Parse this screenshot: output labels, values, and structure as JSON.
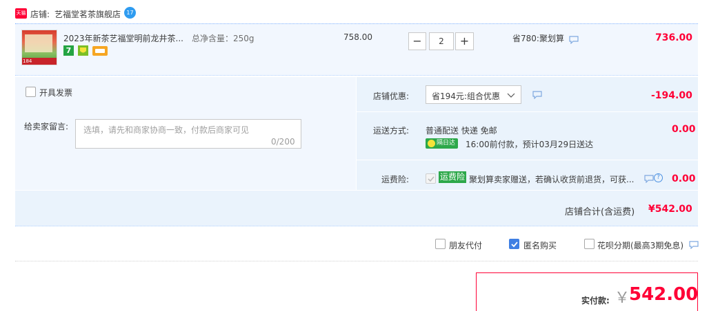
{
  "shop": {
    "badge": "天猫",
    "label": "店铺:",
    "name": "艺福堂茗茶旗舰店"
  },
  "item": {
    "thumb_badges": [
      "184",
      "口感赛艺福鲜新"
    ],
    "title": "2023年新茶艺福堂明前龙井茶...",
    "spec": "总净含量：250g",
    "service_icons": [
      "7"
    ],
    "unit_price": "758.00",
    "quantity": "2",
    "minus": "−",
    "plus": "+",
    "discount": "省780:聚划算",
    "subtotal": "736.00"
  },
  "invoice": {
    "label": "开具发票"
  },
  "message": {
    "label": "给卖家留言:",
    "placeholder": "选填，请先和商家协商一致，付款后商家可见",
    "counter": "0/200"
  },
  "shop_discount": {
    "label": "店铺优惠:",
    "select_value": "省194元:组合优惠",
    "amount": "-194.00"
  },
  "shipping": {
    "label": "运送方式:",
    "method": "普通配送 快递 免邮",
    "tag": "隔日达",
    "eta": "16:00前付款，预计03月29日送达",
    "amount": "0.00"
  },
  "insurance": {
    "label": "运费险:",
    "tag": "运费险",
    "text": "聚划算卖家赠送，若确认收货前退货，可获...",
    "amount": "0.00"
  },
  "shop_total": {
    "label": "店铺合计(含运费)",
    "amount": "¥542.00"
  },
  "options": {
    "friend_pay": "朋友代付",
    "anonymous": "匿名购买",
    "anonymous_checked": true,
    "huabei": "花呗分期(最高3期免息)"
  },
  "payment": {
    "label": "实付款:",
    "currency": "￥",
    "amount": "542.00"
  },
  "colors": {
    "accent_red": "#ff0036",
    "panel_blue": "#eaf3fc",
    "row_blue": "#f2f7fe",
    "border_blue": "#b2d1ff",
    "checkbox_blue": "#3f7fe3",
    "tag_green": "#2da84a"
  },
  "icons": [
    "tmall-badge-icon",
    "shop-level-icon",
    "chat-icon",
    "chevron-down-icon",
    "help-icon",
    "checkmark-icon"
  ]
}
